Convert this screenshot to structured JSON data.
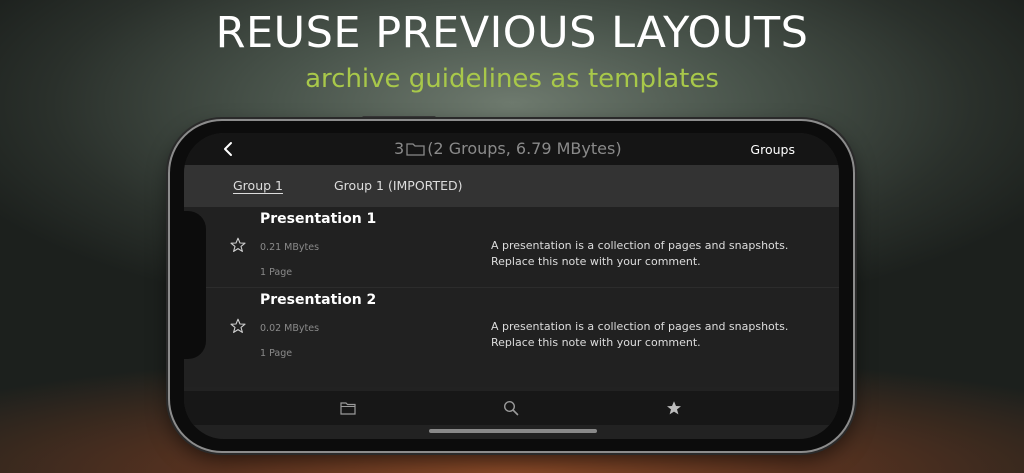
{
  "banner": {
    "headline": "REUSE PREVIOUS LAYOUTS",
    "subhead": "archive guidelines as templates",
    "headline_color": "#ffffff",
    "subhead_color": "#a8c84a"
  },
  "navbar": {
    "count": "3",
    "summary": "(2 Groups, 6.79 MBytes)",
    "groups_label": "Groups",
    "icons": [
      "back-chevron-icon",
      "folder-icon"
    ]
  },
  "tabs": [
    {
      "label": "Group 1",
      "active": true
    },
    {
      "label": "Group 1 (IMPORTED)",
      "active": false
    }
  ],
  "items": [
    {
      "title": "Presentation 1",
      "size": "0.21 MBytes",
      "pages": "1 Page",
      "note_line1": "A presentation is a collection of pages and snapshots.",
      "note_line2": "Replace this note with your comment.",
      "icon": "star-outline-icon"
    },
    {
      "title": "Presentation 2",
      "size": "0.02 MBytes",
      "pages": "1 Page",
      "note_line1": "A presentation is a collection of pages and snapshots.",
      "note_line2": "Replace this note with your comment.",
      "icon": "star-outline-icon"
    }
  ],
  "bottombar": {
    "icons": [
      "folder-icon",
      "search-icon",
      "star-filled-icon"
    ]
  }
}
